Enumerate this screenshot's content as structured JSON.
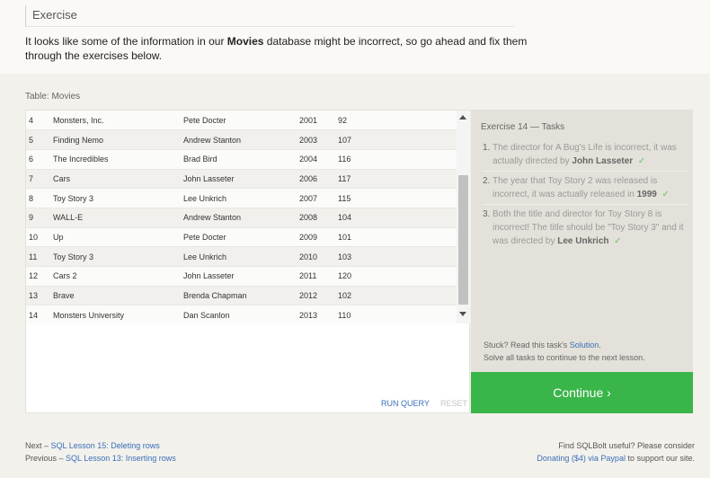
{
  "exercise": {
    "header": "Exercise",
    "intro_prefix": "It looks like some of the information in our ",
    "intro_bold": "Movies",
    "intro_suffix": " database might be incorrect, so go ahead and fix them through the exercises below."
  },
  "table": {
    "label": "Table: Movies",
    "rows": [
      {
        "id": "4",
        "title": "Monsters, Inc.",
        "director": "Pete Docter",
        "year": "2001",
        "length": "92"
      },
      {
        "id": "5",
        "title": "Finding Nemo",
        "director": "Andrew Stanton",
        "year": "2003",
        "length": "107"
      },
      {
        "id": "6",
        "title": "The Incredibles",
        "director": "Brad Bird",
        "year": "2004",
        "length": "116"
      },
      {
        "id": "7",
        "title": "Cars",
        "director": "John Lasseter",
        "year": "2006",
        "length": "117"
      },
      {
        "id": "8",
        "title": "Toy Story 3",
        "director": "Lee Unkrich",
        "year": "2007",
        "length": "115"
      },
      {
        "id": "9",
        "title": "WALL-E",
        "director": "Andrew Stanton",
        "year": "2008",
        "length": "104"
      },
      {
        "id": "10",
        "title": "Up",
        "director": "Pete Docter",
        "year": "2009",
        "length": "101"
      },
      {
        "id": "11",
        "title": "Toy Story 3",
        "director": "Lee Unkrich",
        "year": "2010",
        "length": "103"
      },
      {
        "id": "12",
        "title": "Cars 2",
        "director": "John Lasseter",
        "year": "2011",
        "length": "120"
      },
      {
        "id": "13",
        "title": "Brave",
        "director": "Brenda Chapman",
        "year": "2012",
        "length": "102"
      },
      {
        "id": "14",
        "title": "Monsters University",
        "director": "Dan Scanlon",
        "year": "2013",
        "length": "110"
      }
    ],
    "run_query": "RUN QUERY",
    "reset": "RESET"
  },
  "tasks": {
    "title": "Exercise 14 — Tasks",
    "items": [
      {
        "num": "1.",
        "text": "The director for A Bug's Life is incorrect, it was actually directed by ",
        "bold": "John Lasseter",
        "after": "",
        "check": "✓"
      },
      {
        "num": "2.",
        "text": "The year that Toy Story 2 was released is incorrect, it was actually released in ",
        "bold": "1999",
        "after": "",
        "check": "✓"
      },
      {
        "num": "3.",
        "text": "Both the title and director for Toy Story 8 is incorrect! The title should be \"Toy Story 3\" and it was directed by ",
        "bold": "Lee Unkrich",
        "after": "",
        "check": "✓"
      }
    ],
    "stuck_prefix": "Stuck? Read this task's ",
    "stuck_link": "Solution",
    "stuck_suffix": ".",
    "solve_all": "Solve all tasks to continue to the next lesson."
  },
  "continue_button": "Continue ›",
  "footer": {
    "next_prefix": "Next – ",
    "next_link": "SQL Lesson 15: Deleting rows",
    "prev_prefix": "Previous – ",
    "prev_link": "SQL Lesson 13: Inserting rows",
    "find_useful": "Find SQLBolt useful? Please consider",
    "donate_link": "Donating ($4) via Paypal",
    "donate_suffix": " to support our site."
  },
  "colors": {
    "accent_green": "#3ab54a",
    "link_blue": "#3a6fb7",
    "check_green": "#6cc06a"
  }
}
